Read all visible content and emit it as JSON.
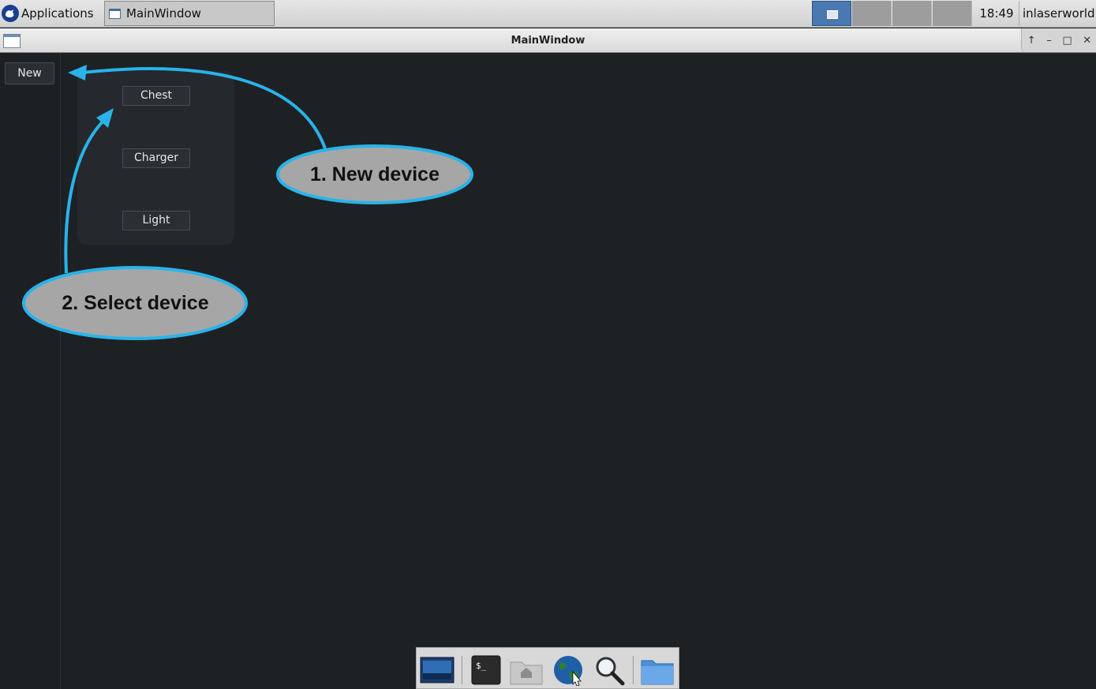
{
  "panel": {
    "applications_label": "Applications",
    "task_title": "MainWindow",
    "clock": "18:49",
    "user": "inlaserworld"
  },
  "window": {
    "title": "MainWindow"
  },
  "app": {
    "new_label": "New",
    "devices": [
      "Chest",
      "Charger",
      "Light"
    ]
  },
  "annotations": {
    "step1": "1. New device",
    "step2": "2. Select device",
    "accent_color": "#29b3ea",
    "callout_fill": "#a6a6a6"
  },
  "dock": {
    "items": [
      "screen-icon",
      "terminal-icon",
      "home-folder-icon",
      "web-browser-icon",
      "search-icon",
      "folder-icon"
    ]
  }
}
